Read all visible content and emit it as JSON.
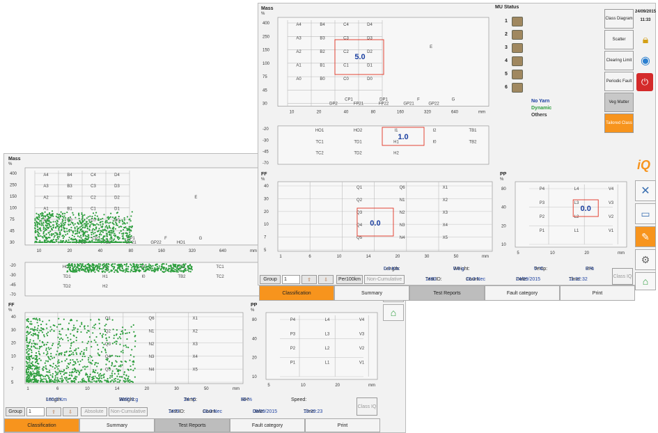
{
  "left": {
    "mass": {
      "label": "Mass",
      "unit": "%",
      "y_ticks": [
        "400",
        "250",
        "150",
        "100",
        "75",
        "45",
        "30"
      ],
      "y_ticks_low": [
        "-20",
        "-30",
        "-45",
        "-70"
      ],
      "x_ticks": [
        "10",
        "20",
        "40",
        "80",
        "160",
        "320",
        "640",
        "mm"
      ],
      "cells": [
        "A4",
        "B4",
        "C4",
        "D4",
        "A3",
        "B3",
        "C3",
        "D3",
        "E",
        "A2",
        "B2",
        "C2",
        "D2",
        "A1",
        "B1",
        "C1",
        "D1",
        "A0",
        "B0",
        "C0",
        "D0",
        "CP1",
        "DP1",
        "F",
        "G",
        "FP21",
        "FP22",
        "GP21",
        "GP22",
        "HO1",
        "HO2",
        "I1",
        "I2",
        "TB1",
        "TC1",
        "TD1",
        "H1",
        "I0",
        "TB2",
        "TC2",
        "TD2",
        "H2"
      ]
    },
    "ff": {
      "label": "FF",
      "unit": "%",
      "y_ticks": [
        "40",
        "30",
        "20",
        "10",
        "7",
        "5"
      ],
      "x_ticks": [
        "1",
        "6",
        "10",
        "14",
        "20",
        "30",
        "50",
        "mm"
      ],
      "cells": [
        "Q1",
        "Q2",
        "Q3",
        "Q4",
        "Q5",
        "Q6",
        "N1",
        "N2",
        "N3",
        "N4",
        "X1",
        "X2",
        "X3",
        "X4",
        "X5"
      ]
    },
    "pp": {
      "label": "PP",
      "unit": "%",
      "y_ticks": [
        "80",
        "40",
        "20",
        "10"
      ],
      "x_ticks": [
        "5",
        "10",
        "20",
        "mm"
      ],
      "cells": [
        "P4",
        "P3",
        "P2",
        "P1",
        "L4",
        "L3",
        "L2",
        "L1",
        "V4",
        "V3",
        "V2",
        "V1"
      ]
    },
    "status": {
      "length_label": "Length:",
      "length": "100.0 Km",
      "weight_label": "Weight:",
      "weight": "3690.0 g",
      "temp_label": "Temp:",
      "temp": "24 °C",
      "rh_label": "RH:",
      "rh": "50 %",
      "speed_label": "Speed:",
      "test_id_label": "Test ID:",
      "test_id": "1479",
      "count_label": "Count:",
      "count": "16.0 Nec",
      "date_label": "Date:",
      "date": "08/09/2015",
      "time_label": "Time:",
      "time": "16:29:23"
    },
    "controls": {
      "group": "Group",
      "group_value": "1",
      "absolute": "Absolute",
      "noncum": "Non-Cumulative",
      "class_iq": "Class IQ"
    },
    "tabs": [
      "Classification",
      "Summary",
      "Test Reports",
      "Fault category",
      "Print"
    ]
  },
  "right": {
    "mass": {
      "label": "Mass",
      "unit": "%",
      "y_ticks": [
        "400",
        "250",
        "150",
        "100",
        "75",
        "45",
        "30"
      ],
      "y_ticks_low": [
        "-20",
        "-30",
        "-45",
        "-70"
      ],
      "x_ticks": [
        "10",
        "20",
        "40",
        "80",
        "160",
        "320",
        "640",
        "mm"
      ],
      "cells": [
        "A4",
        "B4",
        "C4",
        "D4",
        "A3",
        "B3",
        "C3",
        "D3",
        "E",
        "A2",
        "B2",
        "C2",
        "D2",
        "A1",
        "B1",
        "C1",
        "D1",
        "A0",
        "B0",
        "C0",
        "D0",
        "CP1",
        "DP1",
        "F",
        "G",
        "DP2",
        "FP21",
        "FP22",
        "GP21",
        "GP22",
        "HO1",
        "HO2",
        "I1",
        "I2",
        "TB1",
        "TC1",
        "TD1",
        "H1",
        "I0",
        "TB2",
        "TC2",
        "TD2",
        "H2"
      ],
      "value_upper": "5.0",
      "value_lower": "1.0"
    },
    "ff": {
      "label": "FF",
      "unit": "%",
      "y_ticks": [
        "40",
        "30",
        "20",
        "10",
        "7",
        "5"
      ],
      "x_ticks": [
        "1",
        "6",
        "10",
        "14",
        "20",
        "30",
        "50",
        "mm"
      ],
      "cells": [
        "Q1",
        "Q2",
        "Q3",
        "Q4",
        "Q5",
        "Q6",
        "N1",
        "N2",
        "N3",
        "N4",
        "X1",
        "X2",
        "X3",
        "X4",
        "X5"
      ],
      "value": "0.0"
    },
    "pp": {
      "label": "PP",
      "unit": "%",
      "y_ticks": [
        "80",
        "40",
        "20",
        "10"
      ],
      "x_ticks": [
        "5",
        "10",
        "20",
        "mm"
      ],
      "cells": [
        "P4",
        "P3",
        "P2",
        "P1",
        "L4",
        "L3",
        "L2",
        "L1",
        "V4",
        "V3",
        "V2",
        "V1"
      ],
      "value": "0.0"
    },
    "mu_status": {
      "title": "MU Status",
      "items": [
        "1",
        "2",
        "3",
        "4",
        "5",
        "6"
      ],
      "legend": [
        "No Yarn",
        "Dynamic",
        "Others"
      ]
    },
    "side_buttons": [
      "Class Diagram",
      "Scatter",
      "Clearing Limit",
      "Periodic Fault",
      "Veg Matter",
      "Tailored Class"
    ],
    "clock": {
      "date": "24/09/2015",
      "time": "11:33"
    },
    "status": {
      "length_label": "Length:",
      "length": "0.0 Km",
      "weight_label": "Weight:",
      "weight": "0.0 g",
      "temp_label": "Temp:",
      "temp": "0 °C",
      "rh_label": "RH:",
      "rh": "0 %",
      "test_id_label": "Test ID:",
      "test_id": "1480",
      "count_label": "Count:",
      "count": "16.0 Nec",
      "date_label": "Date:",
      "date": "24/09/2015",
      "time_label": "Time:",
      "time": "11:32:32"
    },
    "controls": {
      "group": "Group",
      "group_value": "1",
      "per100": "Per100km",
      "noncum": "Non-Cumulative",
      "class_iq": "Class IQ"
    },
    "tabs": [
      "Classification",
      "Summary",
      "Test Reports",
      "Fault category",
      "Print"
    ]
  },
  "colors": {
    "accent": "#f7941d",
    "scatter": "#2e9e3e",
    "value": "#1a3fa0",
    "highlight": "#e03020"
  },
  "icons": [
    "tools-icon",
    "monitor-icon",
    "report-edit-icon",
    "gears-icon",
    "home-icon",
    "lock-icon",
    "globe-icon",
    "power-icon",
    "iq-logo"
  ]
}
